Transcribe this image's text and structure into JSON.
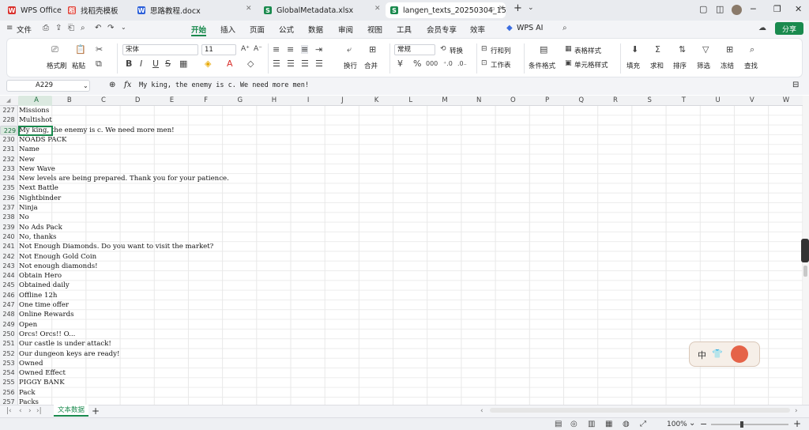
{
  "tabs": [
    {
      "label": "WPS Office",
      "icon": "wps-logo-icon",
      "color": "#d9302c"
    },
    {
      "label": "找稻壳模板",
      "icon": "docer-icon",
      "color": "#e0463d"
    },
    {
      "label": "思路教程.docx",
      "icon": "word-doc-icon",
      "color": "#2b5fd9"
    },
    {
      "label": "GlobalMetadata.xlsx",
      "icon": "sheet-icon",
      "color": "#1a8a4e"
    },
    {
      "label": "langen_texts_20250304_15(",
      "icon": "sheet-icon",
      "color": "#1a8a4e"
    }
  ],
  "menu": {
    "file_label": "文件",
    "items": [
      "开始",
      "插入",
      "页面",
      "公式",
      "数据",
      "审阅",
      "视图",
      "工具",
      "会员专享",
      "效率"
    ],
    "active": "开始",
    "wps_ai": "WPS AI",
    "share": "分享"
  },
  "ribbon": {
    "format_painter": "格式刷",
    "paste": "粘贴",
    "font_name": "宋体",
    "font_size": "11",
    "number_format": "常规",
    "wrap": "换行",
    "merge": "合并",
    "convert": "转换",
    "rows_cols": "行和列",
    "worksheet": "工作表",
    "cond_format": "条件格式",
    "table_style": "表格样式",
    "cell_style": "单元格样式",
    "fill": "填充",
    "sum": "求和",
    "sort": "排序",
    "filter": "筛选",
    "freeze": "冻结",
    "find": "查找"
  },
  "formula_bar": {
    "name_box": "A229",
    "fx_label": "fx",
    "content": "My king, the enemy is c. We need more men!"
  },
  "columns": [
    "A",
    "B",
    "C",
    "D",
    "E",
    "F",
    "G",
    "H",
    "I",
    "J",
    "K",
    "L",
    "M",
    "N",
    "O",
    "P",
    "Q",
    "R",
    "S",
    "T",
    "U",
    "V",
    "W"
  ],
  "rows": [
    {
      "num": "227",
      "text": "Missions"
    },
    {
      "num": "228",
      "text": "Multishot"
    },
    {
      "num": "229",
      "text": "My king, the enemy is c. We need more men!"
    },
    {
      "num": "230",
      "text": "NOADS PACK"
    },
    {
      "num": "231",
      "text": "Name"
    },
    {
      "num": "232",
      "text": "New"
    },
    {
      "num": "233",
      "text": "New Wave"
    },
    {
      "num": "234",
      "text": "New levels are being prepared. Thank you for your patience."
    },
    {
      "num": "235",
      "text": "Next Battle"
    },
    {
      "num": "236",
      "text": "Nightbinder"
    },
    {
      "num": "237",
      "text": "Ninja"
    },
    {
      "num": "238",
      "text": "No"
    },
    {
      "num": "239",
      "text": "No Ads Pack"
    },
    {
      "num": "240",
      "text": "No, thanks"
    },
    {
      "num": "241",
      "text": "Not Enough Diamonds. Do you want to visit the market?"
    },
    {
      "num": "242",
      "text": "Not Enough Gold Coin"
    },
    {
      "num": "243",
      "text": "Not enough diamonds!"
    },
    {
      "num": "244",
      "text": "Obtain Hero"
    },
    {
      "num": "245",
      "text": "Obtained daily"
    },
    {
      "num": "246",
      "text": "Offline 12h"
    },
    {
      "num": "247",
      "text": "One time offer"
    },
    {
      "num": "248",
      "text": "Online Rewards"
    },
    {
      "num": "249",
      "text": "Open"
    },
    {
      "num": "250",
      "text": "Orcs! Orcs!! O..."
    },
    {
      "num": "251",
      "text": "Our castle is under attack!"
    },
    {
      "num": "252",
      "text": "Our dungeon keys are ready!"
    },
    {
      "num": "253",
      "text": "Owned"
    },
    {
      "num": "254",
      "text": "Owned Effect"
    },
    {
      "num": "255",
      "text": "PIGGY BANK"
    },
    {
      "num": "256",
      "text": "Pack"
    },
    {
      "num": "257",
      "text": "Packs"
    }
  ],
  "selected_row": "229",
  "selected_col": "A",
  "sheet": {
    "name": "文本数据",
    "add": "+"
  },
  "status": {
    "zoom": "100%"
  },
  "ime": {
    "label": "中"
  },
  "accent": "#1a8a4e"
}
